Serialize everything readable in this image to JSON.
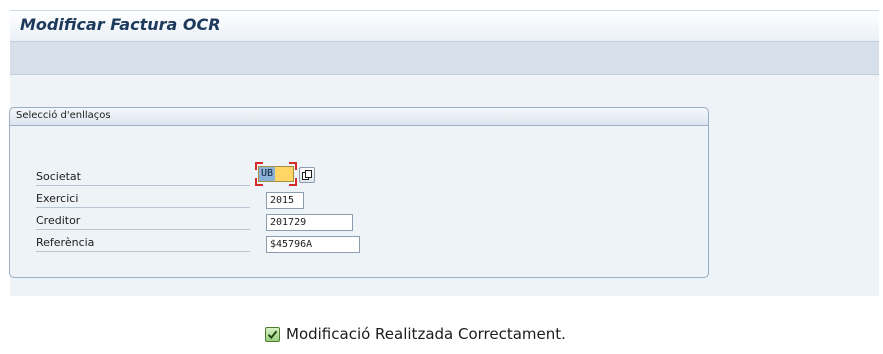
{
  "window": {
    "title": "Modificar Factura OCR"
  },
  "group": {
    "title": "Selecció d'enllaços"
  },
  "fields": [
    {
      "label": "Societat",
      "value": "UB"
    },
    {
      "label": "Exercici",
      "value": "2015"
    },
    {
      "label": "Creditor",
      "value": "201729"
    },
    {
      "label": "Referència",
      "value": "$45796A"
    }
  ],
  "status": {
    "icon": "success-check-icon",
    "message": "Modificació Realitzada Correctament."
  },
  "colors": {
    "title_text": "#1d3a5c",
    "focus_field": "#ffd666",
    "focus_marker": "#d42b2b",
    "success_icon": "#9ccf7f"
  }
}
